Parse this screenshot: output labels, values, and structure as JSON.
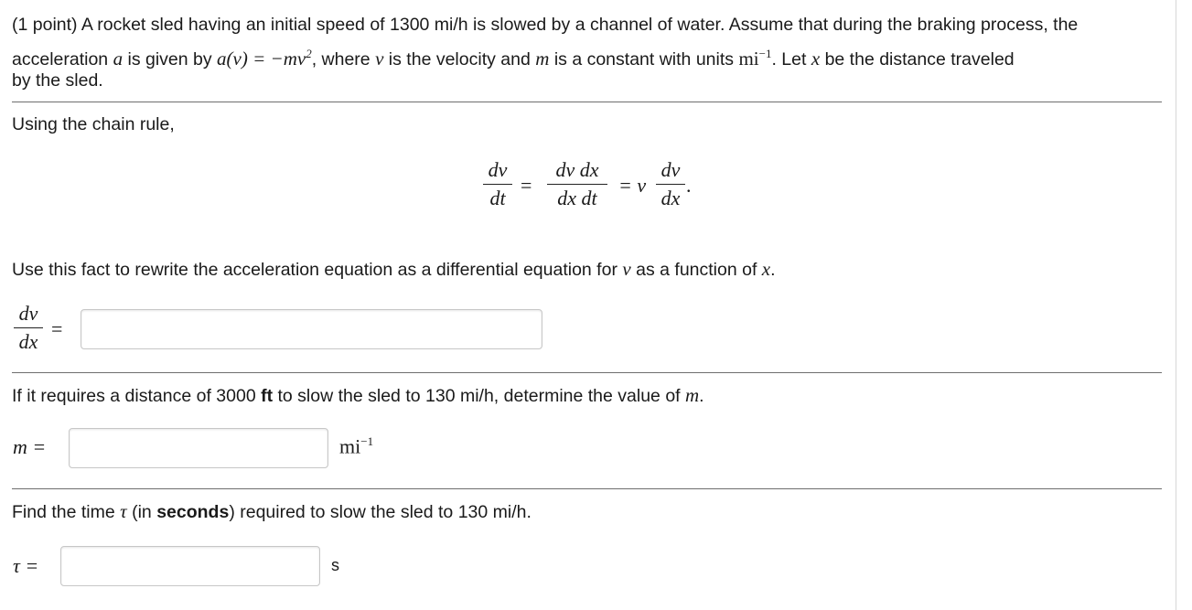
{
  "problem": {
    "intro_1": "(1 point) A rocket sled having an initial speed of 1300 mi/h is slowed by a channel of water. Assume that during the braking process, the",
    "intro_2a": "acceleration ",
    "intro_2b": " is given by ",
    "intro_2c": ", where ",
    "intro_2d": " is the velocity and ",
    "intro_2e": " is a constant with units ",
    "intro_2f": ". Let ",
    "intro_2g": " be the distance traveled",
    "intro_3": "by the sled.",
    "var_a": "a",
    "eq_accel_lhs": "a(v)",
    "eq_accel_rhs": "= −mv",
    "eq_accel_exp": "2",
    "var_v": "v",
    "var_m": "m",
    "unit_mi": "mi",
    "unit_exp": "−1",
    "var_x": "x"
  },
  "chain_rule": {
    "text": "Using the chain rule,",
    "eq": {
      "f1_num": "dv",
      "f1_den": "dt",
      "eq1": "=",
      "f2_num": "dv dx",
      "f2_den": "dx dt",
      "eq2": "= v",
      "f3_num": "dv",
      "f3_den": "dx",
      "period": "."
    }
  },
  "part1": {
    "text_a": "Use this fact to rewrite the acceleration equation as a differential equation for ",
    "var_v": "v",
    "text_b": " as a function of ",
    "var_x": "x",
    "text_c": ".",
    "lhs_num": "dv",
    "lhs_den": "dx",
    "eq": "=",
    "answer": ""
  },
  "part2": {
    "text_a": "If it requires a distance of 3000 ",
    "unit_bold": "ft",
    "text_b": " to slow the sled to 130 mi/h, determine the value of ",
    "var_m": "m",
    "text_c": ".",
    "label": "m =",
    "answer": "",
    "unit": "mi",
    "unit_exp": "−1"
  },
  "part3": {
    "text_a": "Find the time ",
    "var_tau": "τ",
    "text_b": " (in ",
    "bold": "seconds",
    "text_c": ") required to slow the sled to 130 mi/h.",
    "label": "τ =",
    "answer": "",
    "unit": "s"
  }
}
